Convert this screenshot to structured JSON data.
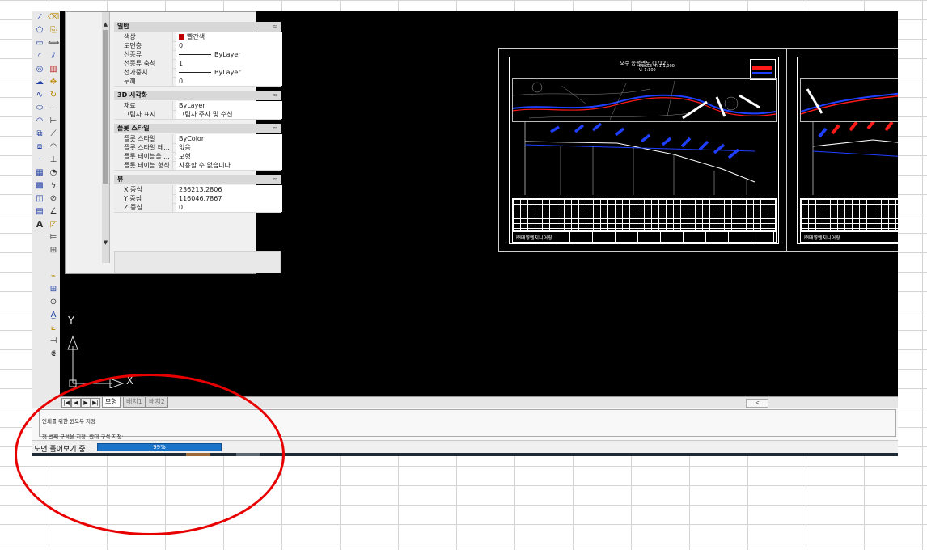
{
  "properties_panel": {
    "sections": [
      {
        "title": "일반",
        "toggle": "≈",
        "rows": [
          {
            "key": "색상",
            "value": "빨간색",
            "swatch": "#c00000"
          },
          {
            "key": "도면층",
            "value": "0"
          },
          {
            "key": "선종류",
            "value": "ByLayer",
            "line": true
          },
          {
            "key": "선종류 축척",
            "value": "1"
          },
          {
            "key": "선가중치",
            "value": "ByLayer",
            "line": true
          },
          {
            "key": "두께",
            "value": "0"
          }
        ]
      },
      {
        "title": "3D 시각화",
        "toggle": "≈",
        "rows": [
          {
            "key": "재료",
            "value": "ByLayer"
          },
          {
            "key": "그림자 표시",
            "value": "그림자 주사 및 수신"
          }
        ]
      },
      {
        "title": "플롯 스타일",
        "toggle": "≈",
        "rows": [
          {
            "key": "플롯 스타일",
            "value": "ByColor"
          },
          {
            "key": "플롯 스타일 테...",
            "value": "없음"
          },
          {
            "key": "플롯 테이블을 ...",
            "value": "모형"
          },
          {
            "key": "플롯 테이블 형식",
            "value": "사용할 수 없습니다."
          }
        ]
      },
      {
        "title": "뷰",
        "toggle": "≈",
        "rows": [
          {
            "key": "X 중심",
            "value": "236213.2806"
          },
          {
            "key": "Y 중심",
            "value": "116046.7867"
          },
          {
            "key": "Z 중심",
            "value": "0"
          }
        ]
      }
    ],
    "scroll_up": "▲",
    "scroll_down": "▼"
  },
  "drawing": {
    "sheet1_title": "오수 종평면도 (1/12)",
    "sheet1_scale": "SCALE",
    "sheet1_scale_h": "H: 1:1,000",
    "sheet1_scale_v": "V: 1:100",
    "company1": "㈜태영엔지니어링",
    "company2": "㈜태영엔지니어링"
  },
  "ucs": {
    "x_label": "X",
    "y_label": "Y"
  },
  "layout_tabs": {
    "nav": [
      "|◀",
      "◀",
      "▶",
      "▶|"
    ],
    "tabs": [
      "모형",
      "배치1",
      "배치2"
    ],
    "hscroll_left": "<"
  },
  "command_line": {
    "line1": "인쇄를 위한 윈도우 지정",
    "line2": "첫 번째 구석을 지정: 반대 구석 지정:"
  },
  "status": {
    "text": "도면 풀어보기 중...",
    "progress": 0.99,
    "progress_label": "99%"
  },
  "colors": {
    "annotation": "#e80000",
    "progress_fill": "#1873c9",
    "canvas": "#000000",
    "plot_blue": "#1f3fff",
    "plot_red": "#ff1a1a"
  },
  "icons": [
    "line-icon",
    "polyline-icon",
    "circle-icon",
    "arc-icon",
    "rectangle-icon",
    "polygon-icon",
    "spline-icon",
    "ellipse-icon",
    "hatch-icon",
    "text-icon",
    "move-icon",
    "copy-icon",
    "rotate-icon",
    "scale-icon",
    "trim-icon",
    "extend-icon",
    "offset-icon",
    "mirror-icon",
    "array-icon",
    "fillet-icon",
    "dimension-icon",
    "leader-icon"
  ]
}
